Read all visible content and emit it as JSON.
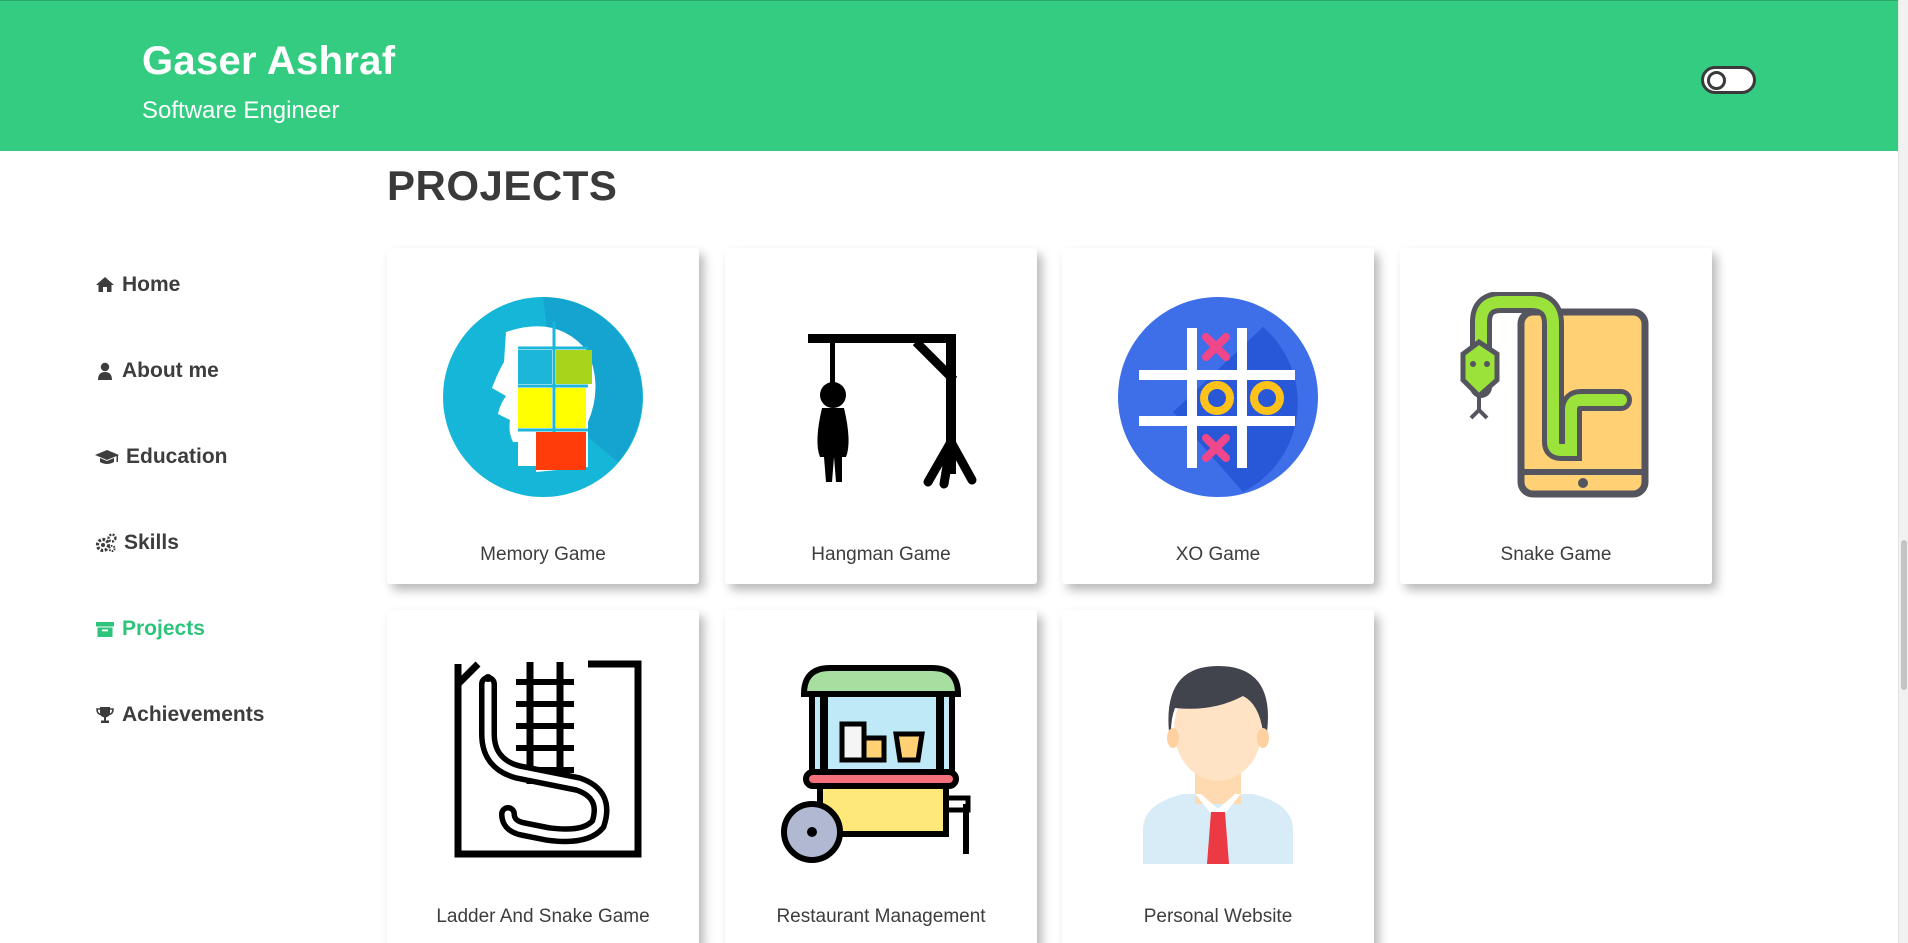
{
  "header": {
    "name": "Gaser Ashraf",
    "title": "Software Engineer",
    "theme_toggle": "off"
  },
  "sidebar": {
    "items": [
      {
        "label": "Home",
        "icon": "home-icon"
      },
      {
        "label": "About me",
        "icon": "user-icon"
      },
      {
        "label": "Education",
        "icon": "graduation-cap-icon"
      },
      {
        "label": "Skills",
        "icon": "gears-icon"
      },
      {
        "label": "Projects",
        "icon": "archive-icon",
        "active": true
      },
      {
        "label": "Achievements",
        "icon": "trophy-icon"
      }
    ]
  },
  "main": {
    "section_title": "PROJECTS",
    "projects": [
      {
        "name": "Memory Game",
        "icon": "brain-grid-icon"
      },
      {
        "name": "Hangman Game",
        "icon": "hangman-icon"
      },
      {
        "name": "XO Game",
        "icon": "tic-tac-toe-icon"
      },
      {
        "name": "Snake Game",
        "icon": "snake-tablet-icon"
      },
      {
        "name": "Ladder And Snake Game",
        "icon": "ladder-snake-icon"
      },
      {
        "name": "Restaurant Management",
        "icon": "food-cart-icon"
      },
      {
        "name": "Personal Website",
        "icon": "person-avatar-icon"
      }
    ]
  },
  "colors": {
    "accent": "#33cc80",
    "active_nav": "#2fc47c",
    "text": "#3d3d3d"
  }
}
